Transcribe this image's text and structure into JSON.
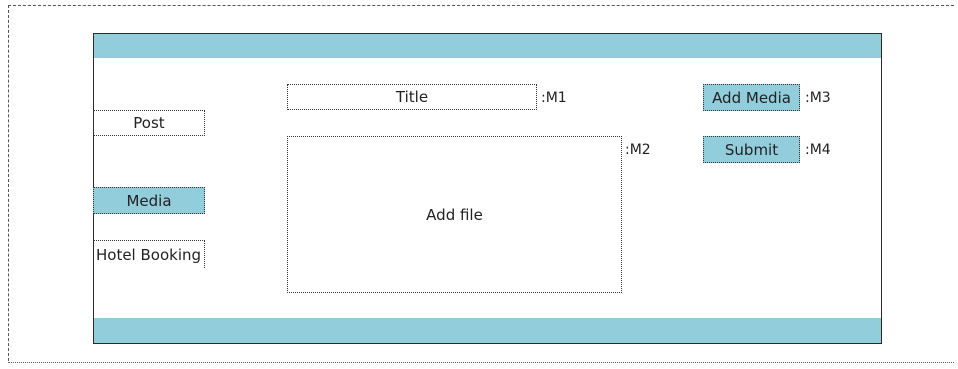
{
  "nav": {
    "post": "Post",
    "media": "Media",
    "hotel_booking": "Hotel Booking"
  },
  "form": {
    "title_field": "Title",
    "title_marker": ":M1",
    "file_area": "Add file",
    "file_marker": ":M2"
  },
  "actions": {
    "add_media": "Add Media",
    "add_media_marker": ":M3",
    "submit": "Submit",
    "submit_marker": ":M4"
  },
  "colors": {
    "accent": "#92cddc",
    "border": "#2a2a2a"
  }
}
